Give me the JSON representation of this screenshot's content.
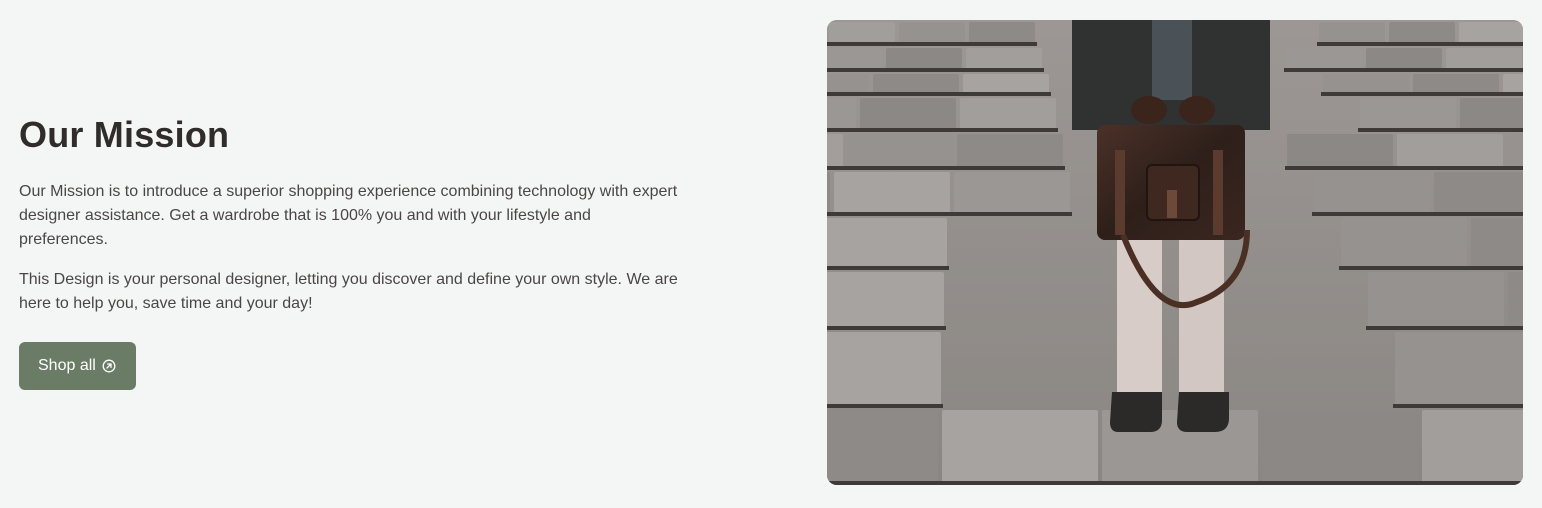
{
  "mission": {
    "heading": "Our Mission",
    "paragraphs": [
      "Our Mission is to introduce a superior shopping experience combining technology with expert designer assistance. Get a wardrobe that is 100% you and with your lifestyle and preferences.",
      "This Design is your personal designer, letting you discover and define your own style. We are here to help you, save time and your day!"
    ],
    "cta_label": "Shop all",
    "cta_icon": "arrow-up-right-circle-icon"
  },
  "image": {
    "subject": "person-with-leather-bag-on-stone-steps"
  },
  "colors": {
    "background": "#f4f6f5",
    "button": "#6a7c66",
    "heading": "#302c2c",
    "body_text": "#4a4646"
  }
}
